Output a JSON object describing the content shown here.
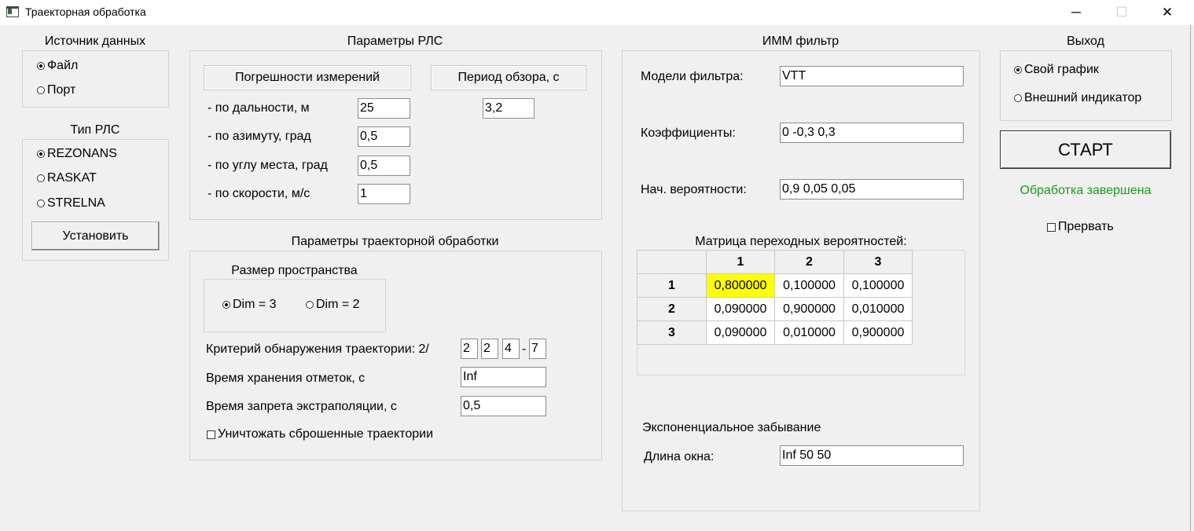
{
  "window": {
    "title": "Траекторная обработка",
    "minimize": "─",
    "maximize": "☐",
    "close": "✕"
  },
  "source": {
    "caption": "Источник данных",
    "options": [
      {
        "label": "Файл",
        "selected": true
      },
      {
        "label": "Порт",
        "selected": false
      }
    ]
  },
  "radar_type": {
    "caption": "Тип РЛС",
    "options": [
      {
        "label": "REZONANS",
        "selected": true
      },
      {
        "label": "RASKAT",
        "selected": false
      },
      {
        "label": "STRELNA",
        "selected": false
      }
    ],
    "set_button": "Установить"
  },
  "radar_params": {
    "caption": "Параметры РЛС",
    "errors_header": "Погрешности измерений",
    "period_header": "Период обзора, с",
    "period_value": "3,2",
    "rows": [
      {
        "label": "- по дальности, м",
        "value": "25"
      },
      {
        "label": "- по азимуту, град",
        "value": "0,5"
      },
      {
        "label": "- по углу места, град",
        "value": "0,5"
      },
      {
        "label": "- по скорости, м/с",
        "value": "1"
      }
    ]
  },
  "track_params": {
    "caption": "Параметры траекторной обработки",
    "space_caption": "Размер пространства",
    "dim_options": [
      {
        "label": "Dim = 3",
        "selected": true
      },
      {
        "label": "Dim = 2",
        "selected": false
      }
    ],
    "criterion_label": "Критерий обнаружения траектории: 2/",
    "criterion_values": [
      "2",
      "2",
      "4",
      "7"
    ],
    "criterion_dash": "-",
    "storage_label": "Время хранения отметок, с",
    "storage_value": "Inf",
    "extrap_label": "Время запрета экстраполяции, с",
    "extrap_value": "0,5",
    "destroy_label": "Уничтожать сброшенные траектории",
    "destroy_checked": false
  },
  "imm": {
    "caption": "ИММ фильтр",
    "models_label": "Модели фильтра:",
    "models_value": "VTT",
    "coef_label": "Коэффициенты:",
    "coef_value": "0 -0,3 0,3",
    "prob_label": "Нач. вероятности:",
    "prob_value": "0,9 0,05 0,05",
    "matrix_caption": "Матрица переходных вероятностей:",
    "matrix_cols": [
      "1",
      "2",
      "3"
    ],
    "matrix_rows": [
      {
        "label": "1",
        "values": [
          "0,800000",
          "0,100000",
          "0,100000"
        ]
      },
      {
        "label": "2",
        "values": [
          "0,090000",
          "0,900000",
          "0,010000"
        ]
      },
      {
        "label": "3",
        "values": [
          "0,090000",
          "0,010000",
          "0,900000"
        ]
      }
    ],
    "forget_caption": "Экспоненциальное забывание",
    "window_label": "Длина окна:",
    "window_value": "Inf 50 50"
  },
  "output": {
    "caption": "Выход",
    "options": [
      {
        "label": "Свой график",
        "selected": true
      },
      {
        "label": "Внешний индикатор",
        "selected": false
      }
    ],
    "start_button": "СТАРТ",
    "status": "Обработка завершена",
    "status_color": "#1a9a1a",
    "abort_label": "Прервать",
    "abort_checked": false
  }
}
